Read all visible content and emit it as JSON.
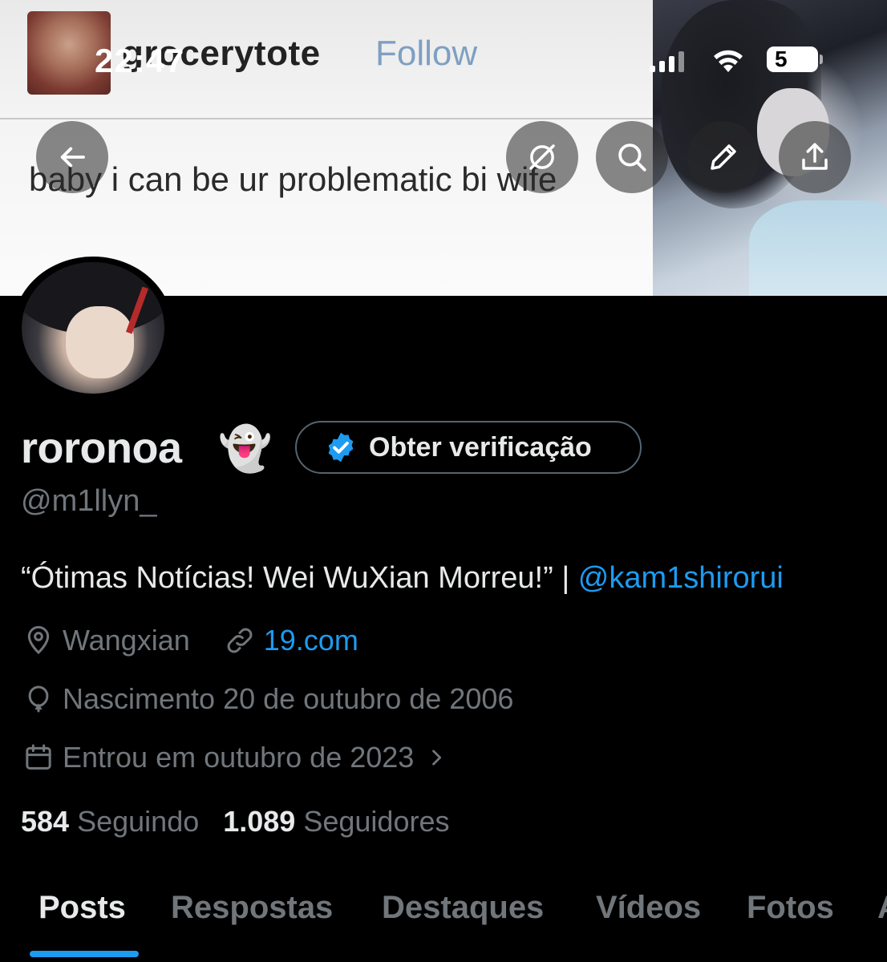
{
  "status_bar": {
    "time": "22:47",
    "battery": "5"
  },
  "banner": {
    "screenshot_username": "grocerytote",
    "screenshot_follow": "Follow",
    "screenshot_caption": "baby i can be ur problematic bi wife"
  },
  "header_buttons": {
    "back": "back-arrow-icon",
    "grok": "grok-icon",
    "search": "search-icon",
    "edit": "pencil-icon",
    "share": "share-icon"
  },
  "profile": {
    "display_name": "roronoa",
    "display_emoji": "👻",
    "verify_label": "Obter verificação",
    "handle": "@m1llyn_",
    "bio_text": "“Ótimas Notícias! Wei WuXian Morreu!” | ",
    "bio_mention": "@kam1shirorui",
    "location": "Wangxian",
    "website": "19.com",
    "birthday": "Nascimento 20 de outubro de 2006",
    "joined": "Entrou em outubro de 2023",
    "following_count": "584",
    "following_label": "Seguindo",
    "followers_count": "1.089",
    "followers_label": "Seguidores"
  },
  "tabs": [
    {
      "label": "Posts",
      "active": true
    },
    {
      "label": "Respostas",
      "active": false
    },
    {
      "label": "Destaques",
      "active": false
    },
    {
      "label": "Vídeos",
      "active": false
    },
    {
      "label": "Fotos",
      "active": false
    },
    {
      "label": "A",
      "active": false
    }
  ],
  "colors": {
    "accent": "#1d9bf0",
    "background": "#000000",
    "primary_text": "#e7e9ea",
    "secondary_text": "#71767b"
  }
}
